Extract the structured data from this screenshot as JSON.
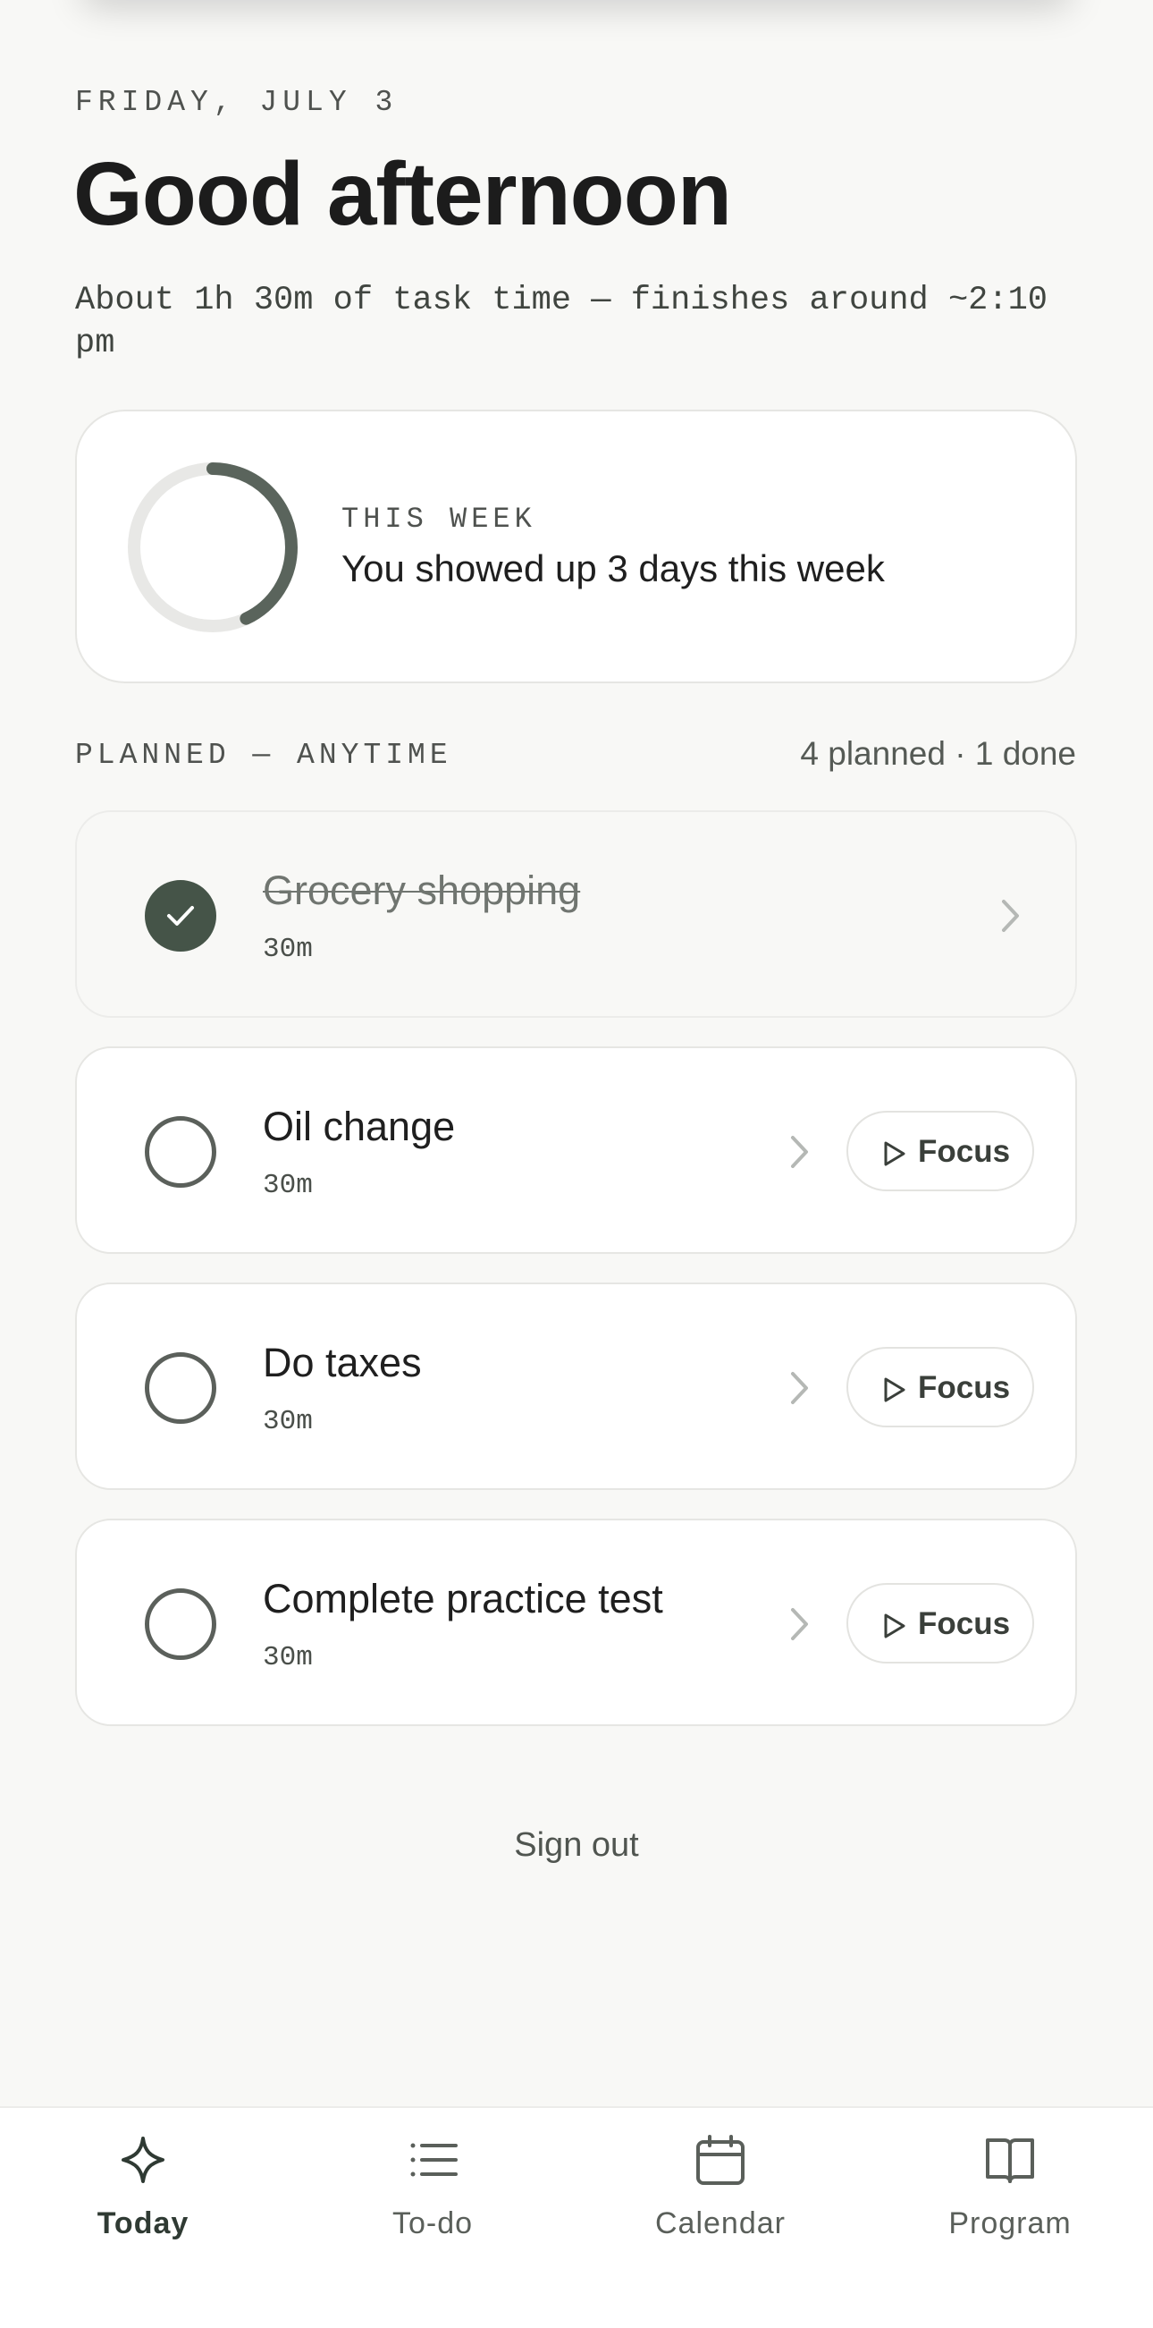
{
  "header": {
    "date": "FRIDAY, JULY 3",
    "greeting": "Good afternoon",
    "summary": "About 1h 30m of task time — finishes around ~2:10 pm"
  },
  "week_card": {
    "label": "THIS WEEK",
    "text": "You showed up 3 days this week",
    "progress_fraction": 0.43
  },
  "planned": {
    "label": "PLANNED — ANYTIME",
    "count": "4 planned · 1 done",
    "tasks": [
      {
        "title": "Grocery shopping",
        "duration": "30m",
        "done": true
      },
      {
        "title": "Oil change",
        "duration": "30m",
        "done": false,
        "focus_label": "Focus"
      },
      {
        "title": "Do taxes",
        "duration": "30m",
        "done": false,
        "focus_label": "Focus"
      },
      {
        "title": "Complete practice test",
        "duration": "30m",
        "done": false,
        "focus_label": "Focus"
      }
    ]
  },
  "signout_label": "Sign out",
  "tabbar": {
    "tabs": [
      {
        "label": "Today",
        "icon": "sparkle-icon",
        "active": true
      },
      {
        "label": "To-do",
        "icon": "list-icon",
        "active": false
      },
      {
        "label": "Calendar",
        "icon": "calendar-icon",
        "active": false
      },
      {
        "label": "Program",
        "icon": "book-icon",
        "active": false
      }
    ]
  },
  "colors": {
    "accent": "#455448",
    "ring_track": "#e8e8e6",
    "ring_fill": "#5a645c",
    "background": "#f8f8f6"
  }
}
